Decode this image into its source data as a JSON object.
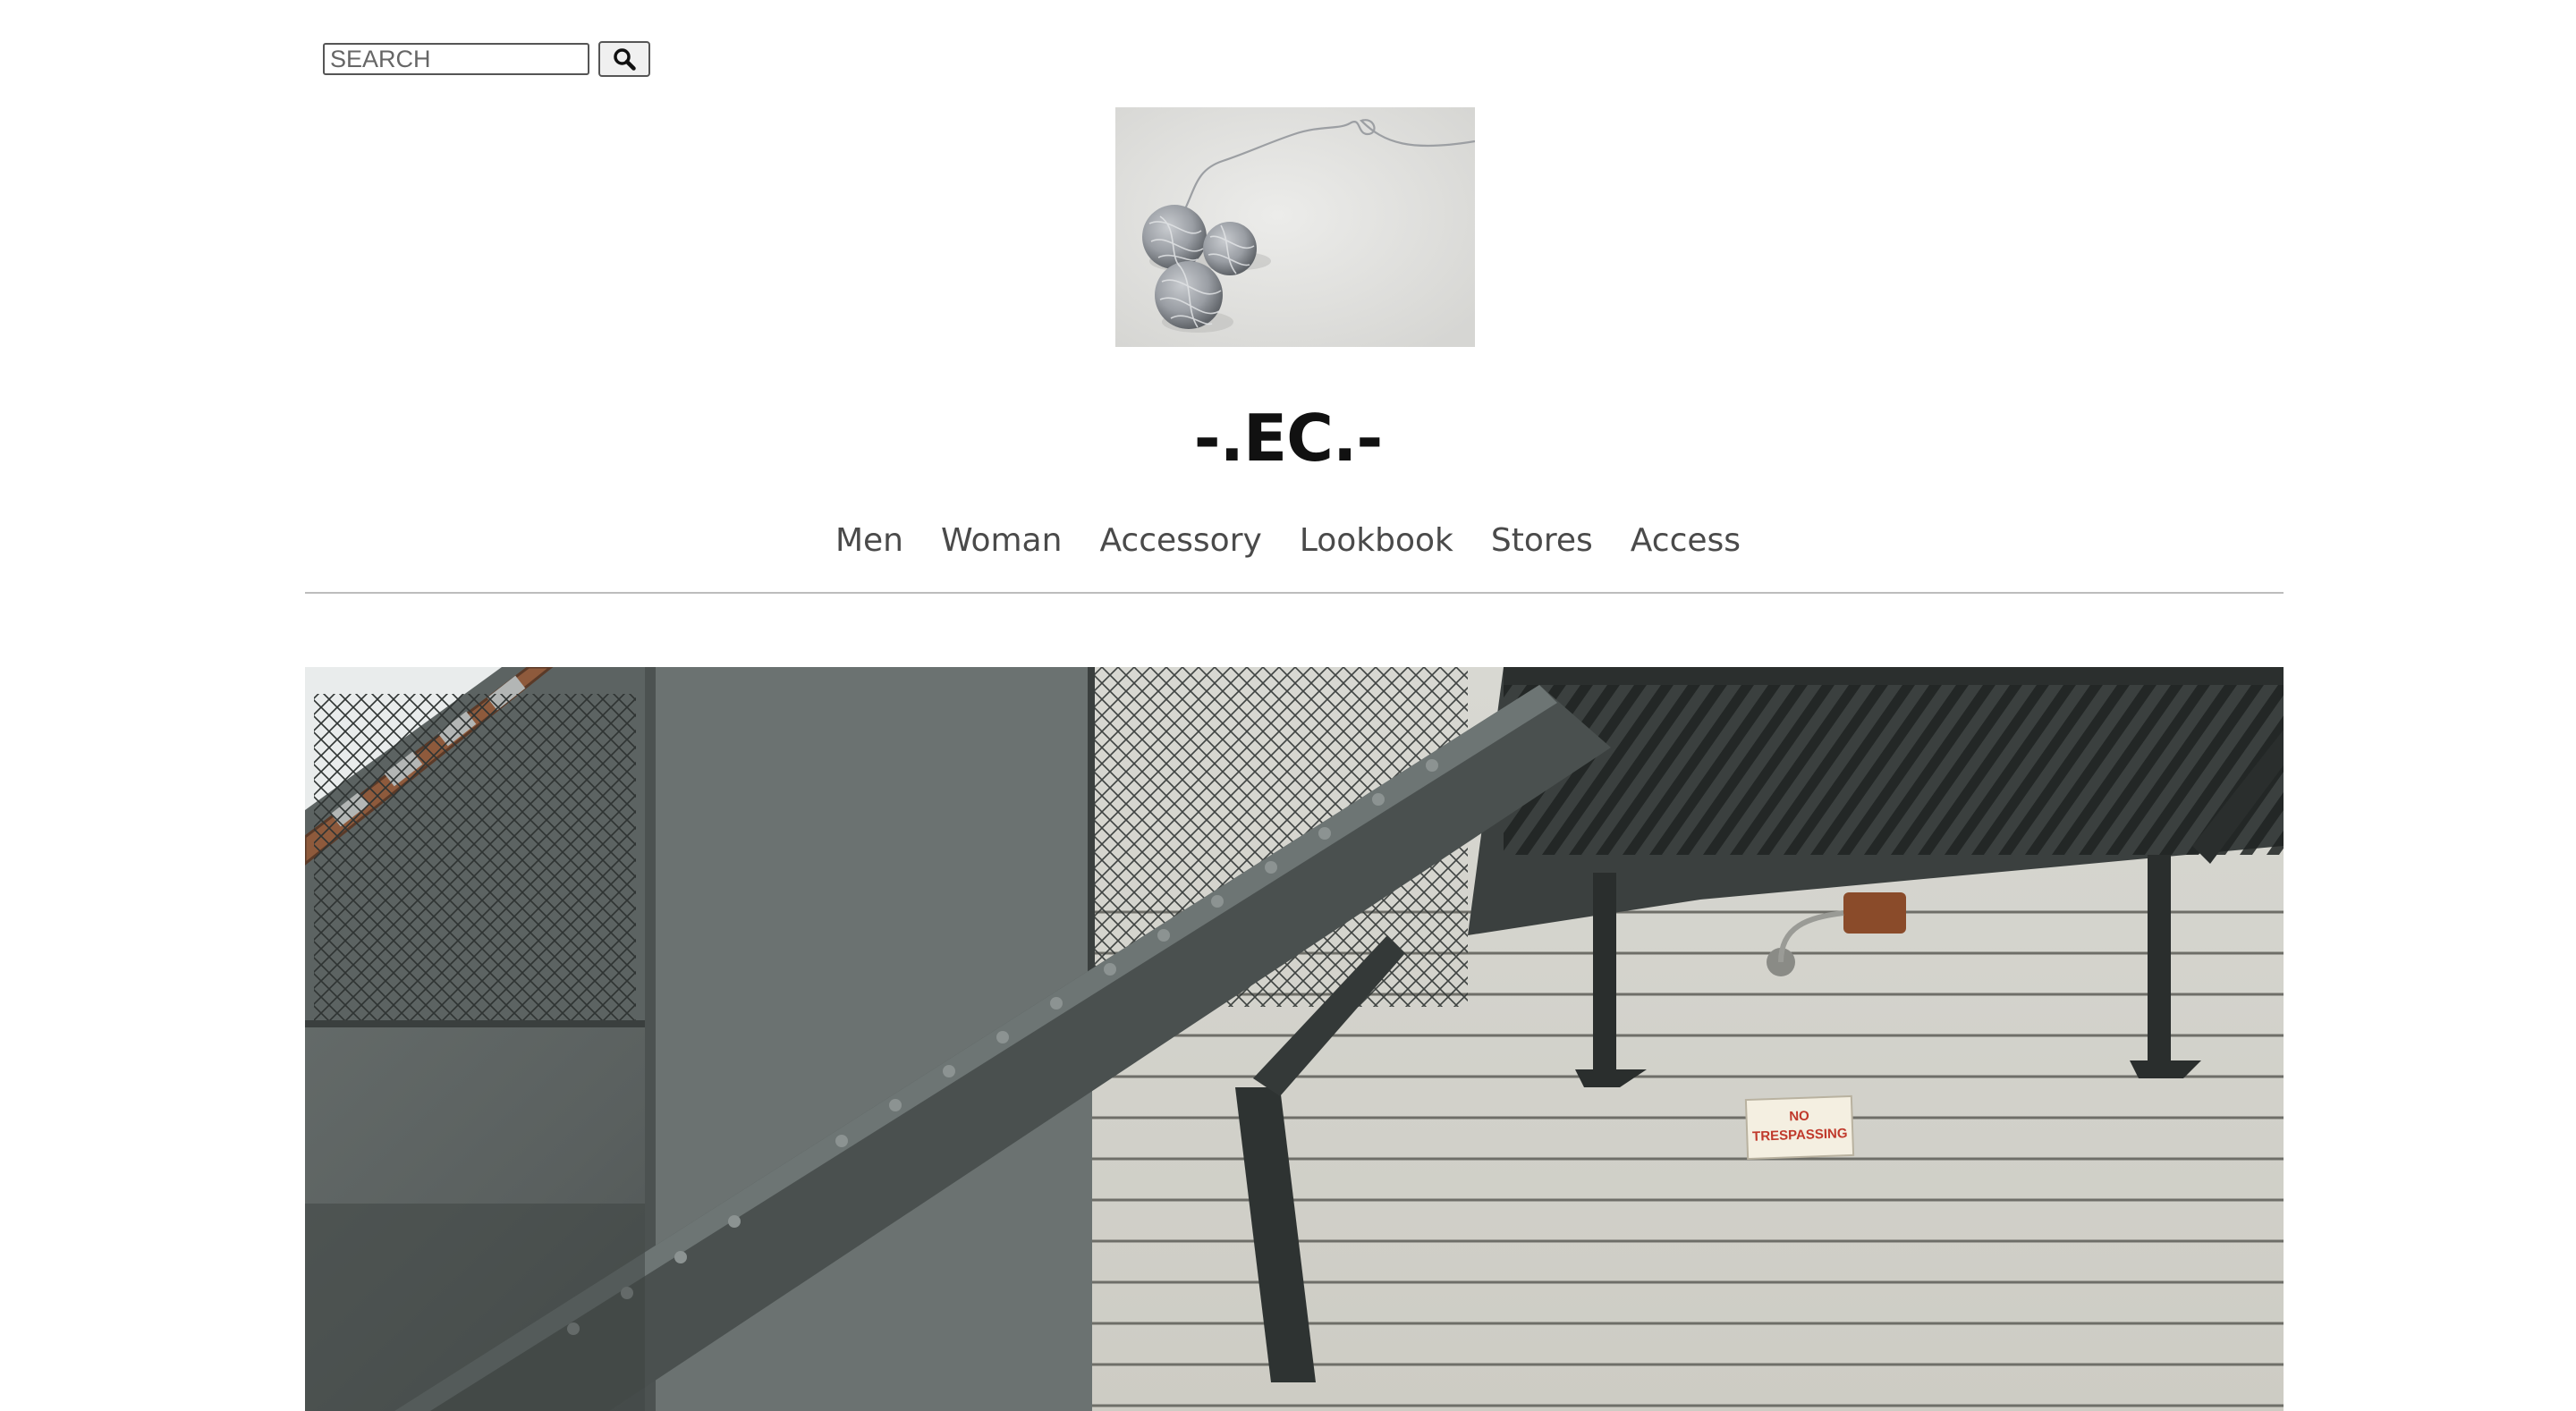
{
  "search": {
    "placeholder": "SEARCH",
    "value": "",
    "button_icon": "search-icon"
  },
  "logo": {
    "description_icon": "yarn-balls-image"
  },
  "site": {
    "title": "-.EC.-"
  },
  "nav": {
    "items": [
      {
        "label": "Men"
      },
      {
        "label": "Woman"
      },
      {
        "label": "Accessory"
      },
      {
        "label": "Lookbook"
      },
      {
        "label": "Stores"
      },
      {
        "label": "Access"
      }
    ]
  },
  "hero": {
    "sign_line1": "NO",
    "sign_line2": "TRESPASSING"
  },
  "colors": {
    "text": "#111111",
    "nav_text": "#4a4a4a",
    "divider": "#bdbdbd",
    "sign_red": "#c0392b"
  }
}
